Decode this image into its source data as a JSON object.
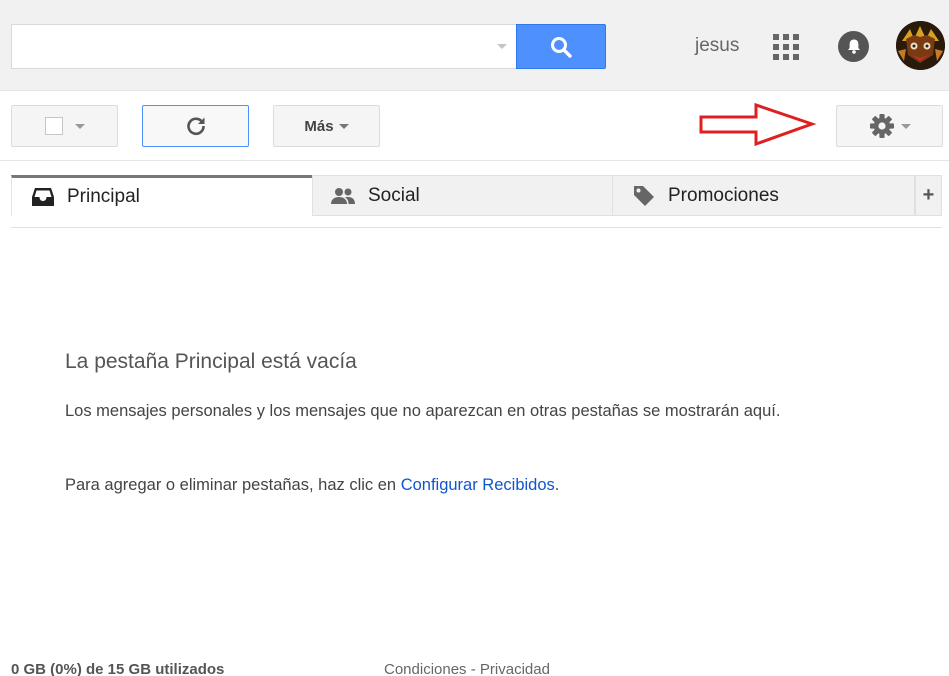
{
  "header": {
    "search_value": "",
    "user_name": "jesus",
    "accent_color": "#4d90fe"
  },
  "toolbar": {
    "more_label": "Más",
    "annotation_arrow_color": "#e02020"
  },
  "tabs": [
    {
      "label": "Principal",
      "icon": "inbox-icon",
      "active": true
    },
    {
      "label": "Social",
      "icon": "people-icon",
      "active": false
    },
    {
      "label": "Promociones",
      "icon": "tag-icon",
      "active": false
    }
  ],
  "tab_add_label": "+",
  "empty_state": {
    "title": "La pestaña Principal está vacía",
    "description": "Los mensajes personales y los mensajes que no aparezcan en otras pestañas se mostrarán aquí.",
    "hint_prefix": "Para agregar o eliminar pestañas, haz clic en ",
    "hint_link": "Configurar Recibidos",
    "hint_suffix": "."
  },
  "footer": {
    "storage": "0 GB (0%) de 15 GB utilizados",
    "terms": "Condiciones",
    "separator": " - ",
    "privacy": "Privacidad"
  }
}
